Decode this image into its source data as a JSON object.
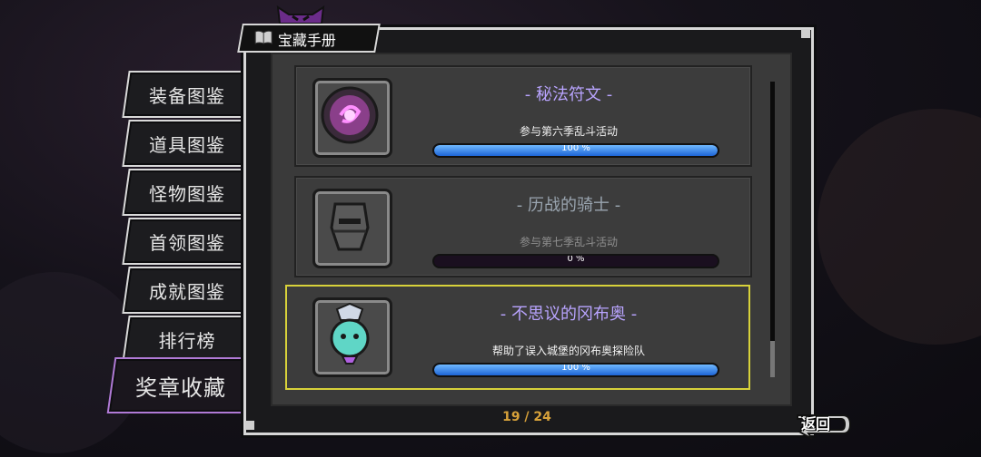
{
  "header": {
    "title": "宝藏手册"
  },
  "tabs": [
    {
      "label": "装备图鉴",
      "active": false
    },
    {
      "label": "道具图鉴",
      "active": false
    },
    {
      "label": "怪物图鉴",
      "active": false
    },
    {
      "label": "首领图鉴",
      "active": false
    },
    {
      "label": "成就图鉴",
      "active": false
    },
    {
      "label": "排行榜",
      "active": false
    },
    {
      "label": "奖章收藏",
      "active": true
    }
  ],
  "medals": [
    {
      "title": "- 秘法符文 -",
      "desc": "参与第六季乱斗活动",
      "progress": 100,
      "progress_label": "100 %",
      "unlocked": true,
      "icon": "arcane-rune-icon"
    },
    {
      "title": "- 历战的骑士 -",
      "desc": "参与第七季乱斗活动",
      "progress": 0,
      "progress_label": "0 %",
      "unlocked": false,
      "icon": "veteran-knight-icon"
    },
    {
      "title": "- 不思议的冈布奥 -",
      "desc": "帮助了误入城堡的冈布奥探险队",
      "progress": 100,
      "progress_label": "100 %",
      "unlocked": true,
      "selected": true,
      "icon": "gumball-robot-icon"
    }
  ],
  "pager": {
    "text": "19 / 24"
  },
  "back_button": {
    "label": "返回"
  },
  "colors": {
    "unlocked_title": "#b9a4ff",
    "locked_title": "#9aa5b0",
    "selected_border": "#d8d23a",
    "progress_fill": "#1d64d6",
    "pager": "#d8a23a",
    "active_tab_border": "#b07ad6"
  }
}
